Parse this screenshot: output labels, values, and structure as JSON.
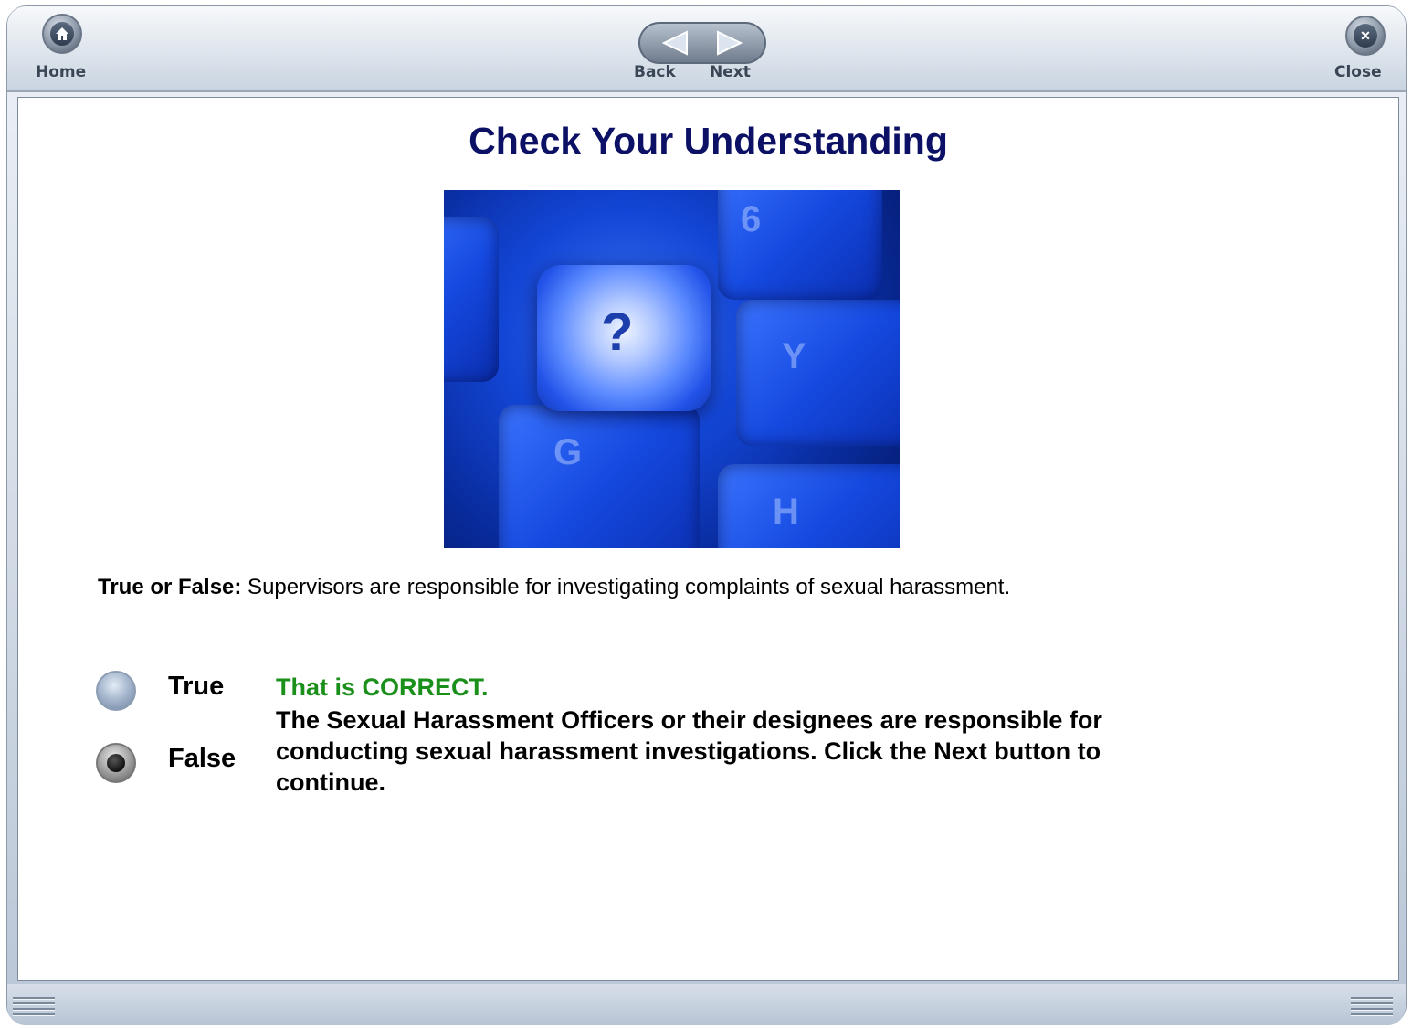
{
  "toolbar": {
    "home_label": "Home",
    "back_label": "Back",
    "next_label": "Next",
    "close_label": "Close"
  },
  "page": {
    "title": "Check Your Understanding",
    "image_icon": "keyboard-question-mark-photo",
    "key_labels": {
      "question": "?",
      "k6": "6",
      "y": "Y",
      "g": "G",
      "h": "H"
    },
    "question_prefix": "True or False:",
    "question_text": " Supervisors are responsible for investigating complaints of sexual harassment."
  },
  "options": [
    {
      "label": "True",
      "selected": false
    },
    {
      "label": "False",
      "selected": true
    }
  ],
  "feedback": {
    "heading": "That is CORRECT.",
    "body": "The Sexual Harassment Officers or their designees are responsible for conducting sexual harassment investigations. Click the Next button to continue.",
    "heading_color": "#1a8f1a"
  },
  "colors": {
    "title": "#0c1166",
    "toolbar_text": "#3a4656"
  }
}
